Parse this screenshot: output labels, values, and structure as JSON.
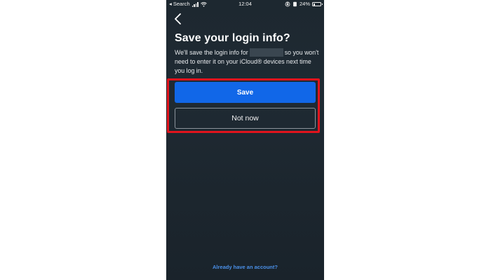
{
  "status_bar": {
    "carrier": "◂ Search",
    "time": "12:04",
    "battery_text": "24%",
    "battery_level": 0.24
  },
  "header": {
    "back_icon": "chevron-left-icon"
  },
  "dialog": {
    "title": "Save your login info?",
    "desc_part1": "We'll save the login info for",
    "desc_part2": "so you won't need to enter it on your iCloud® devices next time you log in."
  },
  "actions": {
    "save_label": "Save",
    "not_now_label": "Not now"
  },
  "footer": {
    "account_link": "Already have an account?"
  },
  "colors": {
    "primary": "#1167e8",
    "highlight": "#e1141d",
    "link": "#4a90e8",
    "background": "#1f2a33"
  }
}
